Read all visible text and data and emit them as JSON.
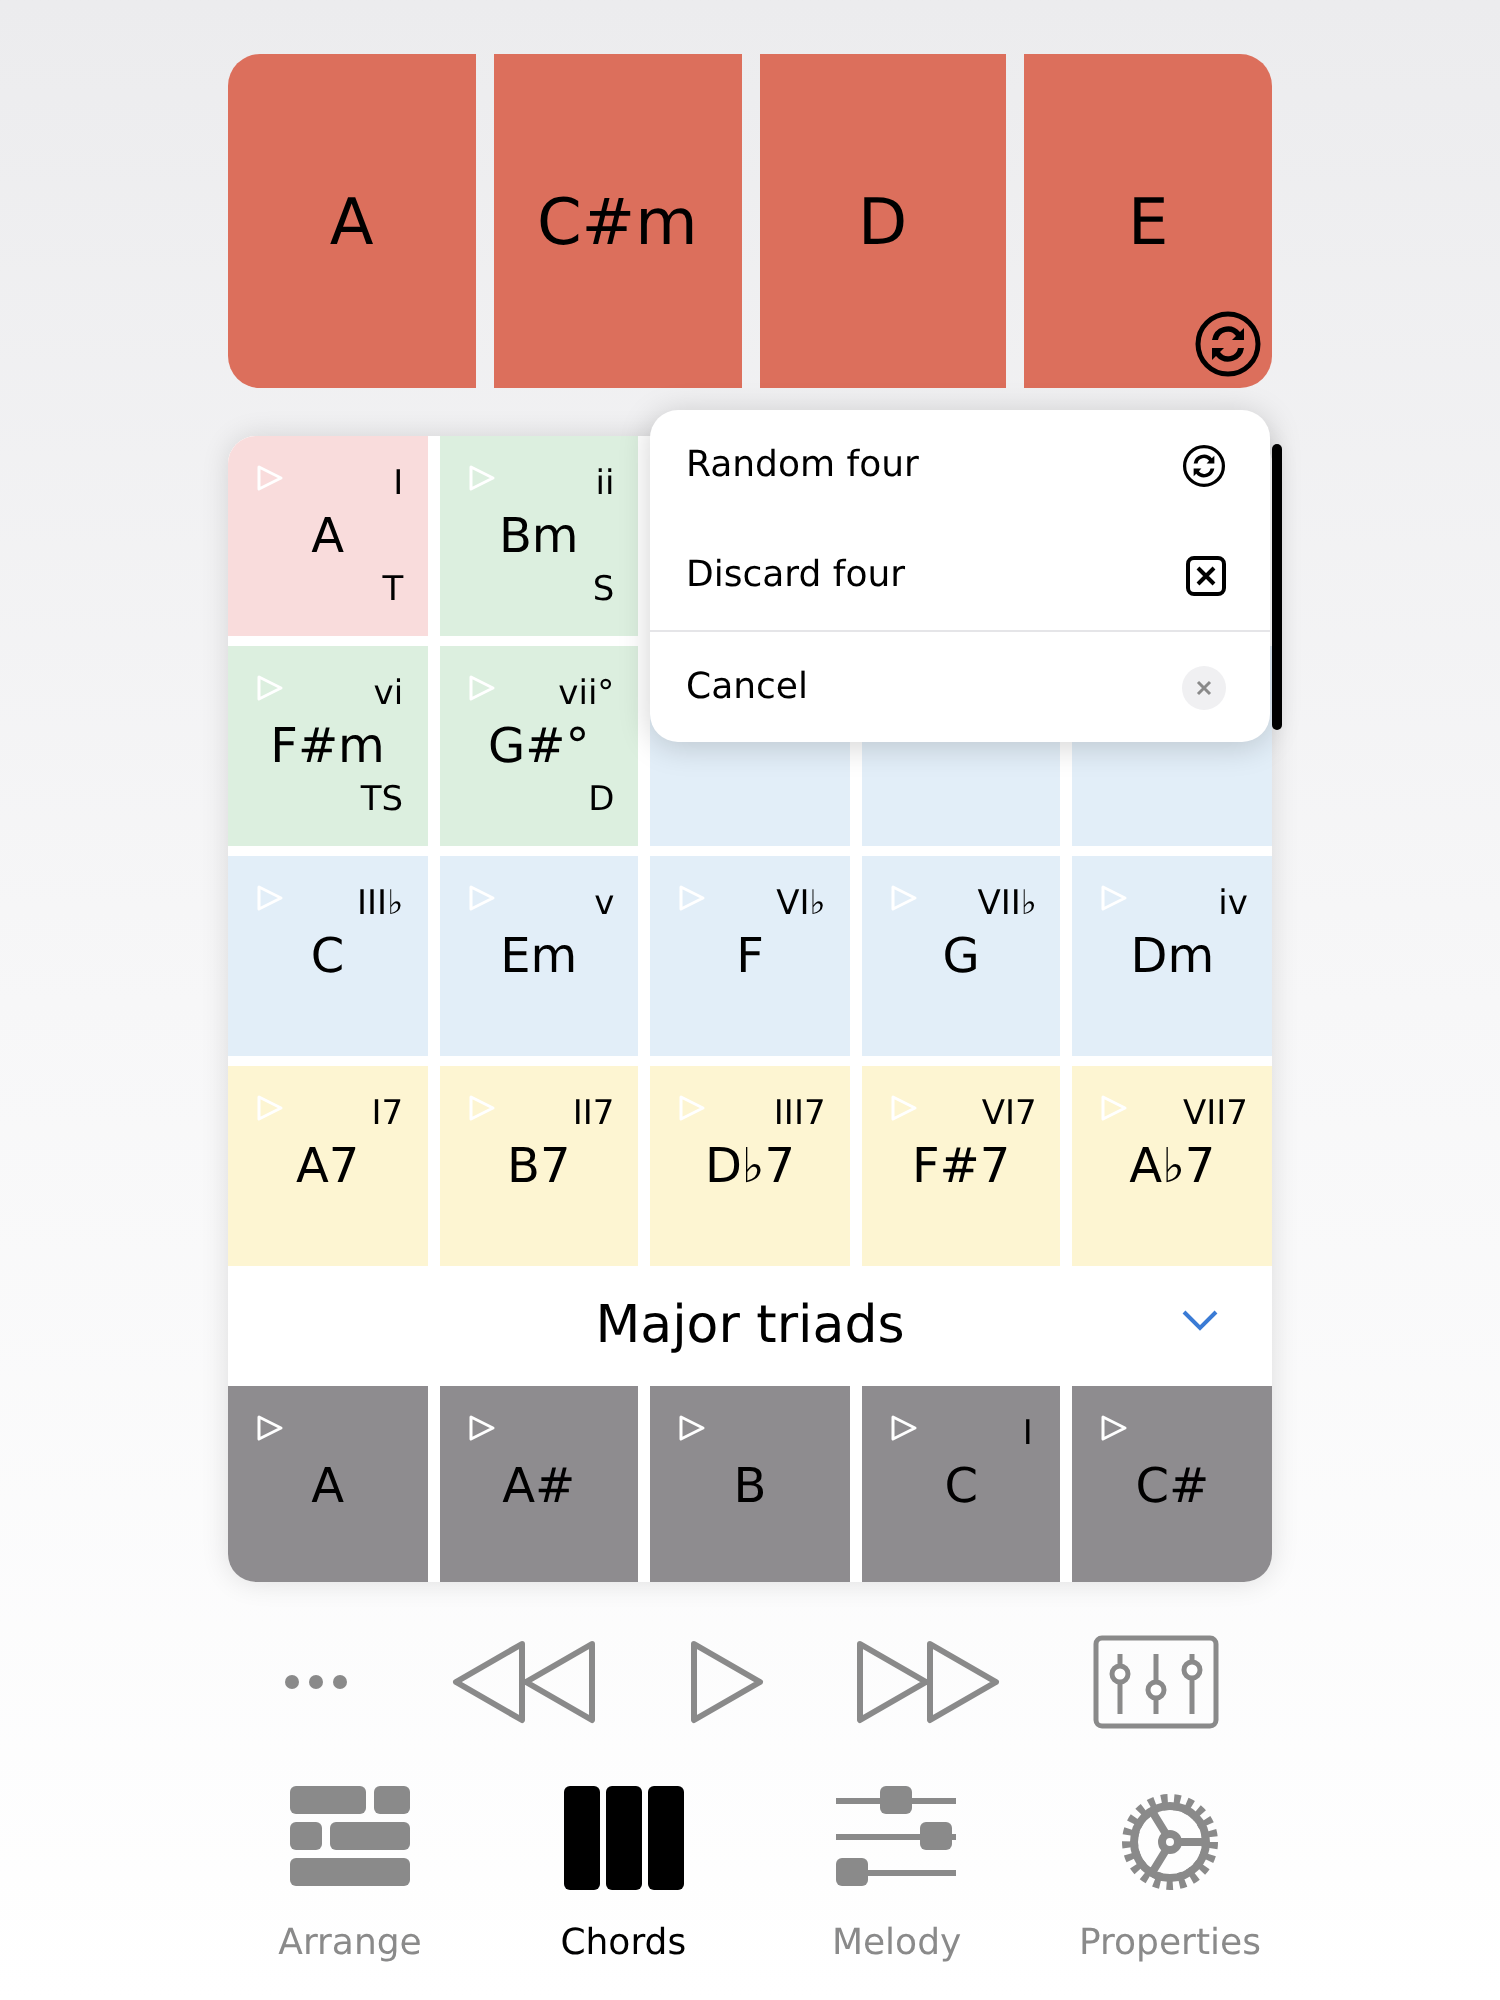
{
  "progression": {
    "chords": [
      "A",
      "C#m",
      "D",
      "E"
    ]
  },
  "grid": {
    "rows": [
      {
        "cells": [
          {
            "kind": "chord",
            "chord": "A",
            "numeral": "I",
            "function": "T",
            "color": "#f9dcdc"
          },
          {
            "kind": "chord",
            "chord": "Bm",
            "numeral": "ii",
            "function": "S",
            "color": "#dcefdf"
          }
        ]
      },
      {
        "cells": [
          {
            "kind": "chord",
            "chord": "F#m",
            "numeral": "vi",
            "function": "TS",
            "color": "#dcefdf"
          },
          {
            "kind": "chord",
            "chord": "G#°",
            "numeral": "vii°",
            "function": "D",
            "color": "#dcefdf"
          },
          {
            "kind": "covered",
            "color": "#e2eef8"
          },
          {
            "kind": "covered",
            "color": "#e2eef8"
          },
          {
            "kind": "covered",
            "color": "#e2eef8"
          }
        ]
      },
      {
        "cells": [
          {
            "kind": "chord",
            "chord": "C",
            "numeral": "III♭",
            "color": "#e2eef8"
          },
          {
            "kind": "chord",
            "chord": "Em",
            "numeral": "v",
            "color": "#e2eef8"
          },
          {
            "kind": "chord",
            "chord": "F",
            "numeral": "VI♭",
            "color": "#e2eef8"
          },
          {
            "kind": "chord",
            "chord": "G",
            "numeral": "VII♭",
            "color": "#e2eef8"
          },
          {
            "kind": "chord",
            "chord": "Dm",
            "numeral": "iv",
            "color": "#e2eef8"
          }
        ]
      },
      {
        "cells": [
          {
            "kind": "chord",
            "chord": "A7",
            "numeral": "I7",
            "color": "#fdf5d2"
          },
          {
            "kind": "chord",
            "chord": "B7",
            "numeral": "II7",
            "color": "#fdf5d2"
          },
          {
            "kind": "chord",
            "chord": "D♭7",
            "numeral": "III7",
            "color": "#fdf5d2"
          },
          {
            "kind": "chord",
            "chord": "F#7",
            "numeral": "VI7",
            "color": "#fdf5d2"
          },
          {
            "kind": "chord",
            "chord": "A♭7",
            "numeral": "VII7",
            "color": "#fdf5d2"
          }
        ]
      }
    ]
  },
  "chord_set": {
    "title": "Major triads",
    "cells": [
      {
        "chord": "A"
      },
      {
        "chord": "A#"
      },
      {
        "chord": "B"
      },
      {
        "chord": "C",
        "numeral": "I"
      },
      {
        "chord": "C#"
      }
    ]
  },
  "menu": {
    "items": [
      {
        "label": "Random four",
        "kind": "random"
      },
      {
        "label": "Discard four",
        "kind": "discard"
      },
      {
        "label": "Cancel",
        "kind": "cancel"
      }
    ]
  },
  "tabs": [
    {
      "label": "Arrange",
      "selected": false,
      "kind": "arrange"
    },
    {
      "label": "Chords",
      "selected": true,
      "kind": "chords"
    },
    {
      "label": "Melody",
      "selected": false,
      "kind": "melody"
    },
    {
      "label": "Properties",
      "selected": false,
      "kind": "properties"
    }
  ]
}
